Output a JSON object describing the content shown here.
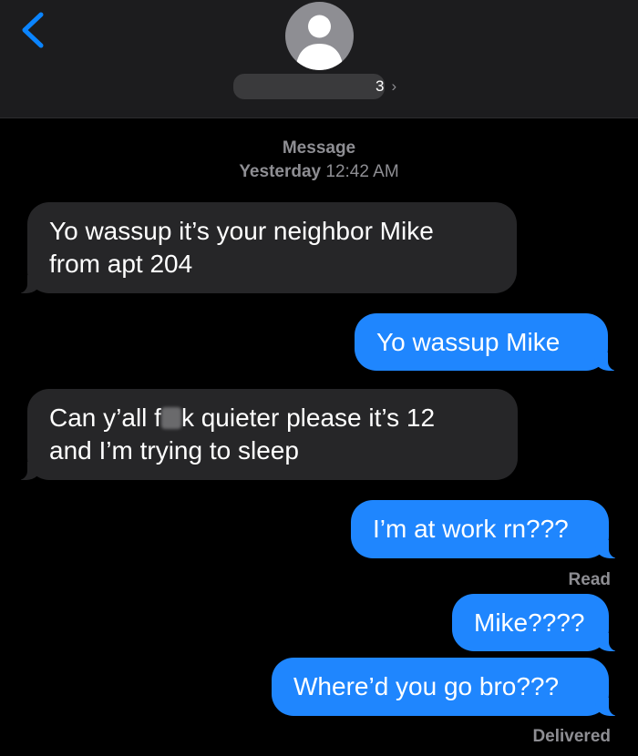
{
  "header": {
    "back_icon": "chevron-left-icon",
    "avatar_icon": "person-icon",
    "contact_suffix": "3",
    "contact_chevron": "›"
  },
  "thread": {
    "service_label": "Message",
    "timestamp_day": "Yesterday",
    "timestamp_time": "12:42 AM"
  },
  "messages": [
    {
      "direction": "incoming",
      "line1": "Yo wassup it’s your neighbor Mike",
      "line2": "from apt 204"
    },
    {
      "direction": "outgoing",
      "text": "Yo wassup Mike"
    },
    {
      "direction": "incoming",
      "line1_a": "Can y’all f",
      "line1_b": "k quieter please it’s 12",
      "line2": "and I’m trying to sleep"
    },
    {
      "direction": "outgoing",
      "text": "I’m at work rn???",
      "status": "Read"
    },
    {
      "direction": "outgoing",
      "text": "Mike????"
    },
    {
      "direction": "outgoing",
      "text": "Where’d you go bro???",
      "status": "Delivered"
    }
  ],
  "colors": {
    "outgoing_bubble": "#1f86fe",
    "incoming_bubble": "#262628",
    "header_bg": "#1c1c1e",
    "accent": "#0a84ff"
  }
}
